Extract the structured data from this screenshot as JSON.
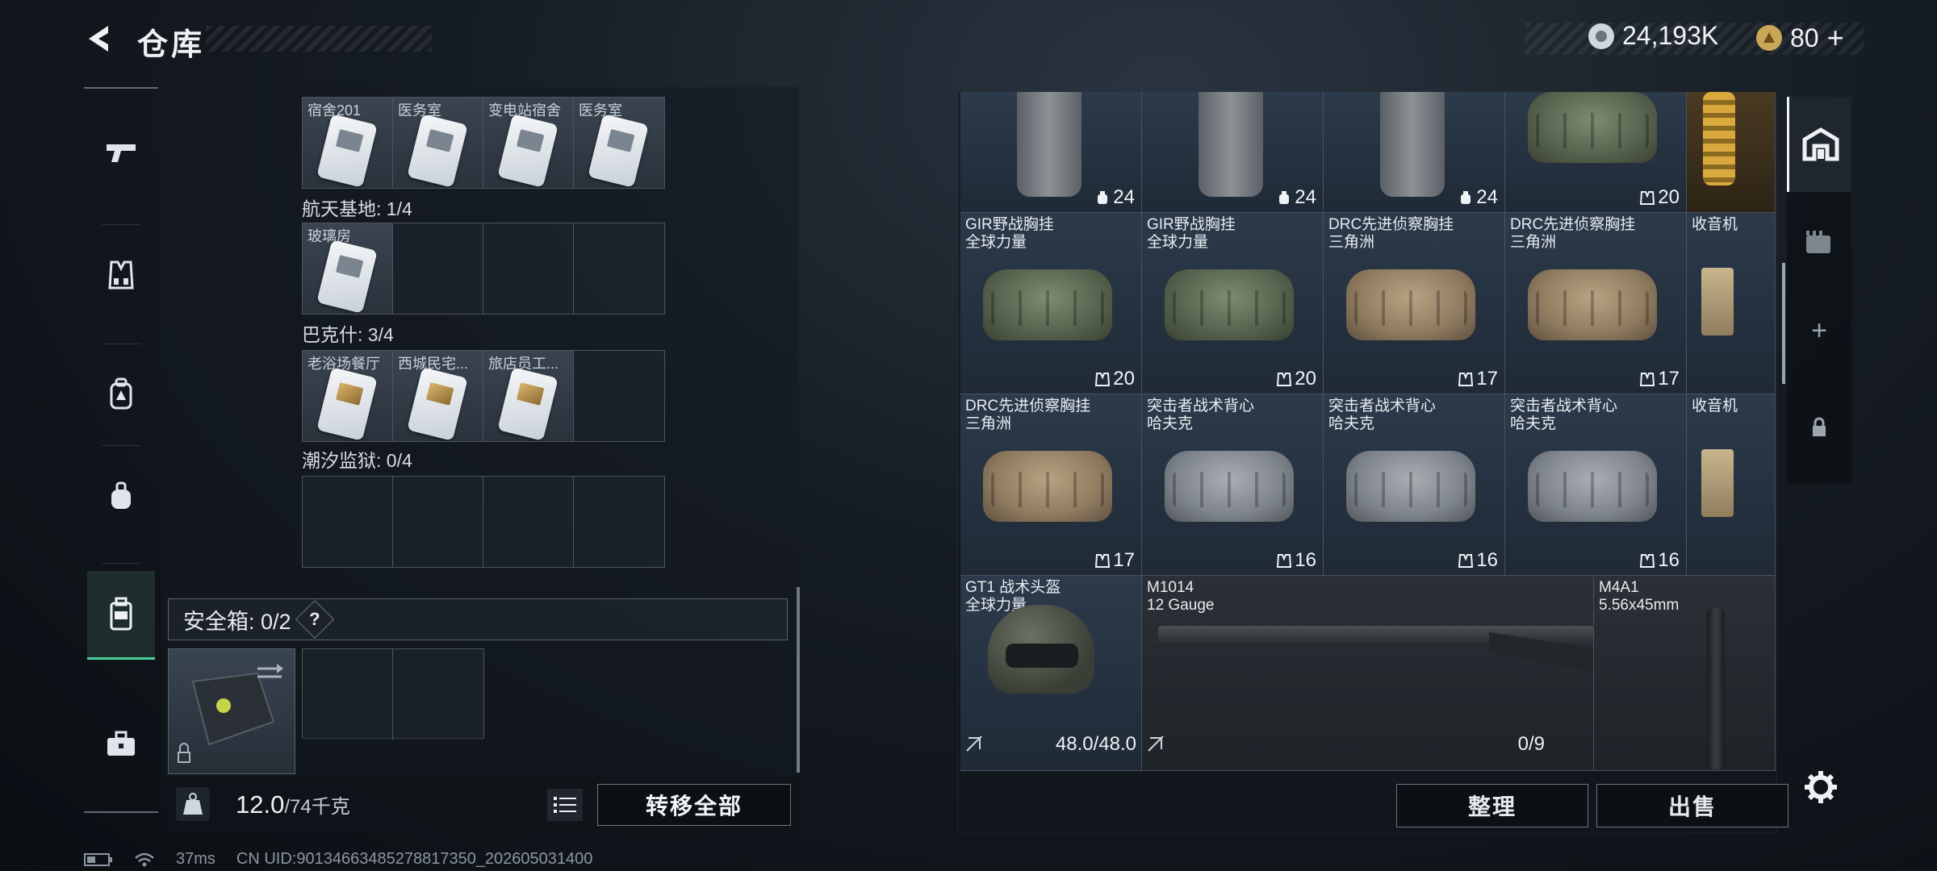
{
  "header": {
    "title": "仓库",
    "currency_amount": "24,193K",
    "token_amount": "80"
  },
  "left_panel": {
    "map_sections": [
      {
        "label": "",
        "slots": [
          "宿舍201",
          "医务室",
          "变电站宿舍",
          "医务室"
        ]
      },
      {
        "label": "航天基地: 1/4",
        "slots": [
          "玻璃房",
          "",
          "",
          ""
        ]
      },
      {
        "label": "巴克什: 3/4",
        "slots": [
          "老浴场餐厅",
          "西城民宅...",
          "旅店员工...",
          ""
        ]
      },
      {
        "label": "潮汐监狱: 0/4",
        "slots": [
          "",
          "",
          "",
          ""
        ]
      }
    ],
    "safe_box_label": "安全箱: 0/2",
    "safe_box_help": "?",
    "weight_value": "12.0",
    "weight_capacity": "/74千克",
    "transfer_all": "转移全部"
  },
  "right_panel": {
    "items": [
      {
        "name_line1": "",
        "name_line2": "",
        "count": "24"
      },
      {
        "name_line1": "",
        "name_line2": "",
        "count": "24"
      },
      {
        "name_line1": "",
        "name_line2": "",
        "count": "24"
      },
      {
        "name_line1": "",
        "name_line2": "",
        "count": "20"
      },
      {
        "name_line1": "",
        "name_line2": "",
        "count": ""
      },
      {
        "name_line1": "GIR野战胸挂",
        "name_line2": "全球力量",
        "count": "20"
      },
      {
        "name_line1": "GIR野战胸挂",
        "name_line2": "全球力量",
        "count": "20"
      },
      {
        "name_line1": "DRC先进侦察胸挂",
        "name_line2": "三角洲",
        "count": "17"
      },
      {
        "name_line1": "DRC先进侦察胸挂",
        "name_line2": "三角洲",
        "count": "17"
      },
      {
        "name_line1": "收音机",
        "name_line2": "",
        "count": ""
      },
      {
        "name_line1": "DRC先进侦察胸挂",
        "name_line2": "三角洲",
        "count": "17"
      },
      {
        "name_line1": "突击者战术背心",
        "name_line2": "哈夫克",
        "count": "16"
      },
      {
        "name_line1": "突击者战术背心",
        "name_line2": "哈夫克",
        "count": "16"
      },
      {
        "name_line1": "突击者战术背心",
        "name_line2": "哈夫克",
        "count": "16"
      },
      {
        "name_line1": "收音机",
        "name_line2": "",
        "count": ""
      },
      {
        "name_line1": "GT1 战术头盔",
        "name_line2": "全球力量",
        "durability": "48.0/48.0"
      },
      {
        "name_line1": "M1014",
        "name_line2": "12 Gauge",
        "ammo": "0/9"
      },
      {
        "name_line1": "M4A1",
        "name_line2": "5.56x45mm"
      }
    ],
    "tidy": "整理",
    "sell": "出售"
  },
  "status_bar": {
    "ping": "37ms",
    "uid": "CN UID:9013466348527881735​0_202605031400"
  },
  "colors": {
    "accent_green": "#4ad19a",
    "panel_bg": "#1f2a36"
  }
}
